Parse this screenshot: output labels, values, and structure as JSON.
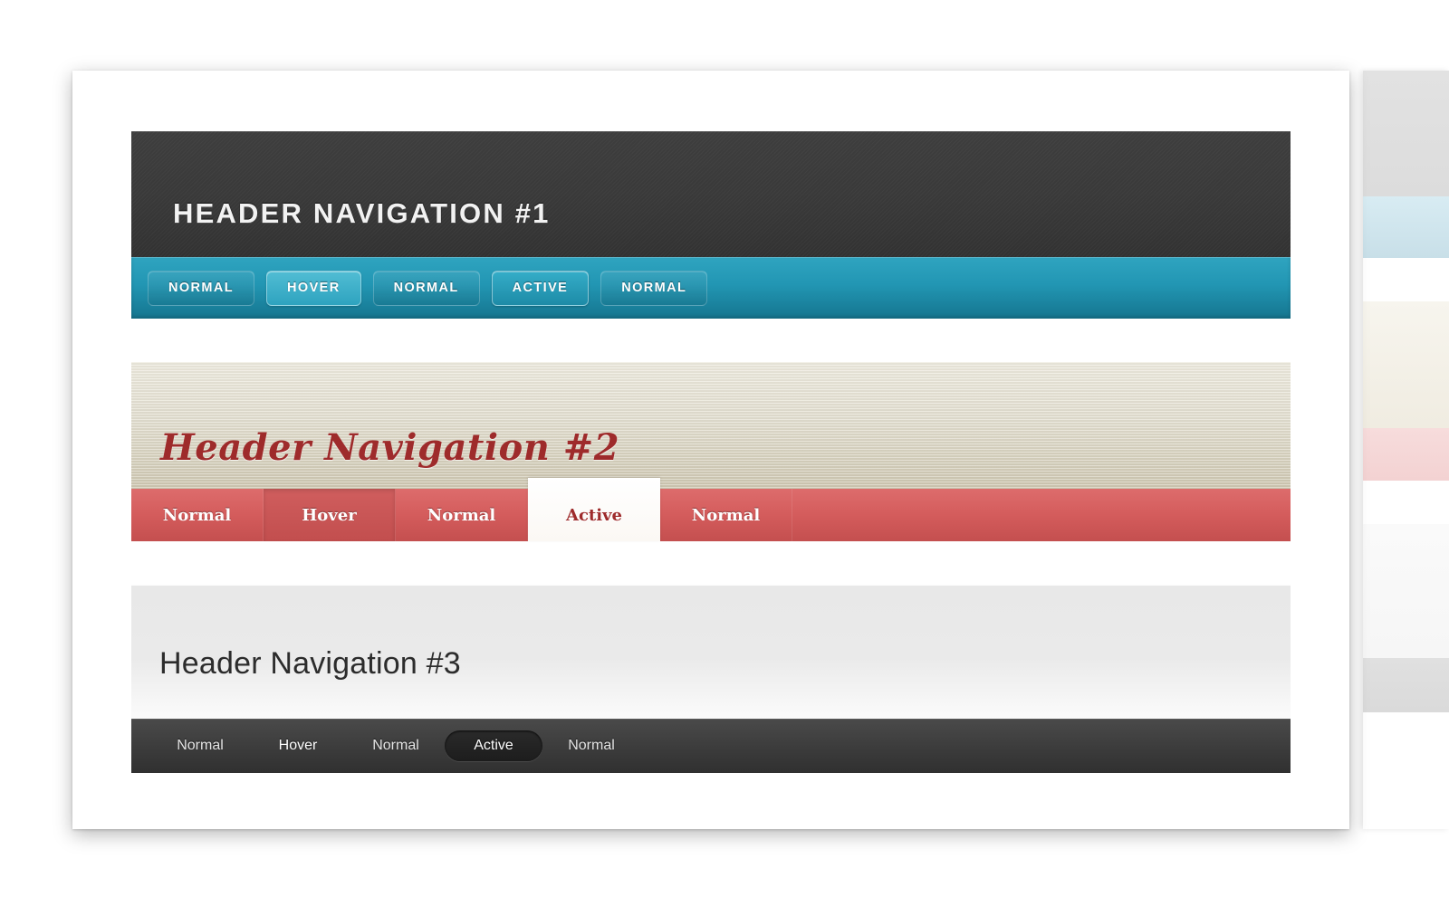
{
  "page": {
    "background_color": "#ffffff",
    "card_background": "#ffffff"
  },
  "blocks": [
    {
      "id": "header-navigation-1",
      "title": "HEADER NAVIGATION #1",
      "header_color": "#3a3a3a",
      "nav_color": "#2296b3",
      "items": [
        {
          "label": "NORMAL",
          "state": "normal"
        },
        {
          "label": "HOVER",
          "state": "hover"
        },
        {
          "label": "NORMAL",
          "state": "normal"
        },
        {
          "label": "ACTIVE",
          "state": "active"
        },
        {
          "label": "NORMAL",
          "state": "normal"
        }
      ]
    },
    {
      "id": "header-navigation-2",
      "title": "Header Navigation #2",
      "header_color": "#e3dfd0",
      "nav_color": "#d45c5c",
      "title_color": "#9e2b2b",
      "items": [
        {
          "label": "Normal",
          "state": "normal"
        },
        {
          "label": "Hover",
          "state": "hover"
        },
        {
          "label": "Normal",
          "state": "normal"
        },
        {
          "label": "Active",
          "state": "active"
        },
        {
          "label": "Normal",
          "state": "normal"
        }
      ]
    },
    {
      "id": "header-navigation-3",
      "title": "Header Navigation #3",
      "header_color": "#eaeaea",
      "nav_color": "#3d3d3d",
      "items": [
        {
          "label": "Normal",
          "state": "normal"
        },
        {
          "label": "Hover",
          "state": "hover"
        },
        {
          "label": "Normal",
          "state": "normal"
        },
        {
          "label": "Active",
          "state": "active"
        },
        {
          "label": "Normal",
          "state": "normal"
        }
      ]
    }
  ]
}
